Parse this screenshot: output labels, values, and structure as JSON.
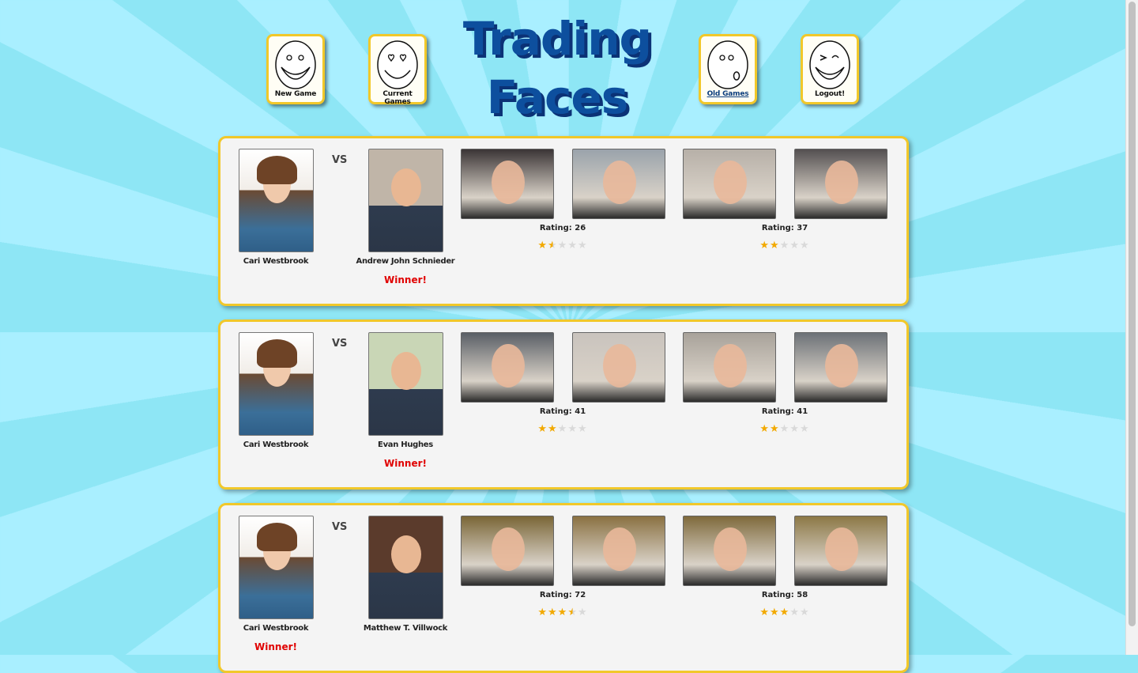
{
  "app": {
    "title": "Trading Faces"
  },
  "nav": [
    {
      "label": "New Game",
      "icon": "smiley-face-icon",
      "link": false
    },
    {
      "label": "Current Games",
      "icon": "heart-eyes-face-icon",
      "link": false
    },
    {
      "label": "Old Games",
      "icon": "kiss-face-icon",
      "link": true
    },
    {
      "label": "Logout!",
      "icon": "winking-face-icon",
      "link": false
    }
  ],
  "vs_label": "VS",
  "winner_label": "Winner!",
  "rating_prefix": "Rating:",
  "games": [
    {
      "player1": {
        "name": "Cari Westbrook",
        "winner": false
      },
      "player2": {
        "name": "Andrew John Schnieder",
        "winner": true
      },
      "rounds": [
        {
          "rating": "Rating: 26",
          "stars": 1.5
        },
        {
          "rating": "Rating: 37",
          "stars": 2
        }
      ]
    },
    {
      "player1": {
        "name": "Cari Westbrook",
        "winner": false
      },
      "player2": {
        "name": "Evan Hughes",
        "winner": true
      },
      "rounds": [
        {
          "rating": "Rating: 41",
          "stars": 2
        },
        {
          "rating": "Rating: 41",
          "stars": 2
        }
      ]
    },
    {
      "player1": {
        "name": "Cari Westbrook",
        "winner": true
      },
      "player2": {
        "name": "Matthew T. Villwock",
        "winner": false
      },
      "rounds": [
        {
          "rating": "Rating: 72",
          "stars": 3.5
        },
        {
          "rating": "Rating: 58",
          "stars": 3
        }
      ]
    }
  ],
  "colors": {
    "accent": "#f1c82a",
    "title": "#0d4f9e",
    "winner": "#e00000",
    "star": "#f2a900"
  }
}
